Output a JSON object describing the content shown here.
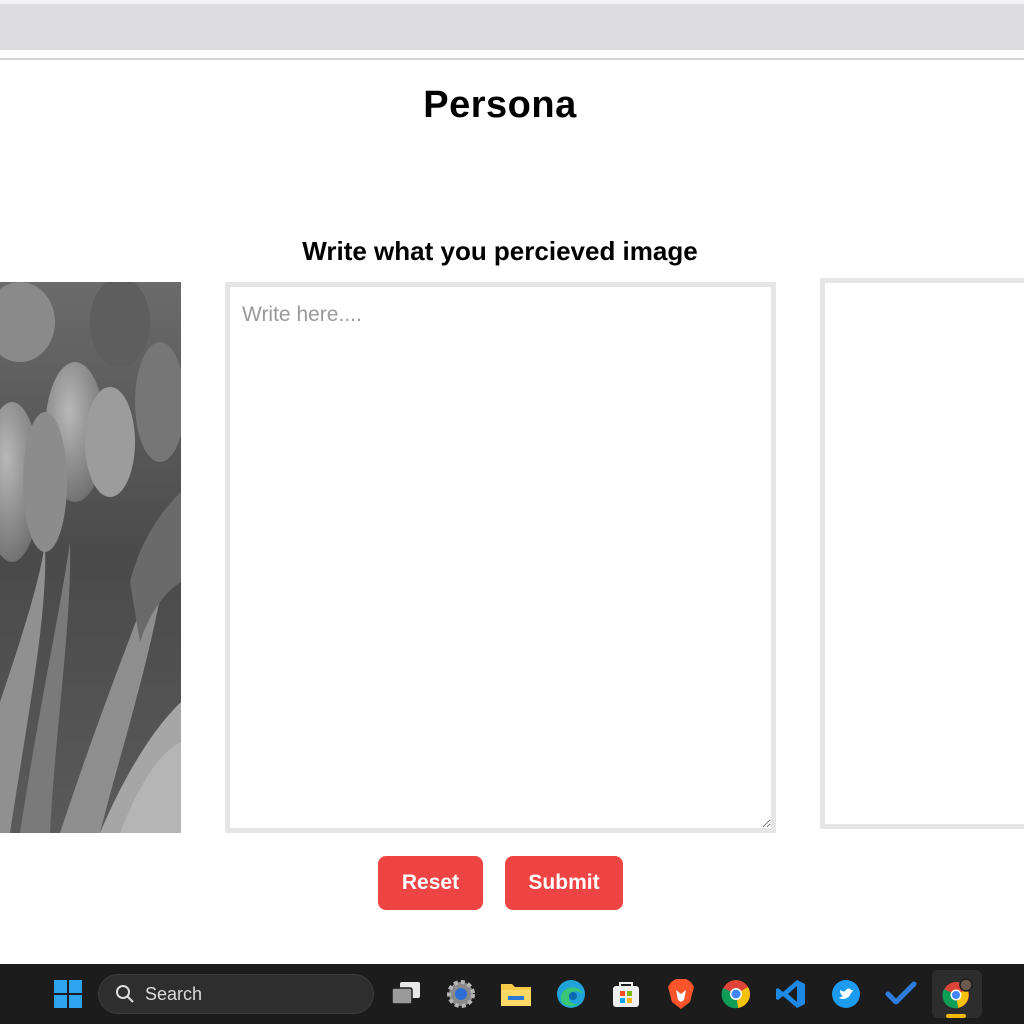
{
  "page": {
    "title": "Persona",
    "heading": "Write what you percieved image"
  },
  "input": {
    "placeholder": "Write here...."
  },
  "buttons": {
    "reset_label": "Reset",
    "submit_label": "Submit"
  },
  "colors": {
    "button_bg": "#ef4444",
    "border": "#e6e6e6",
    "taskbar_bg": "#1c1c1c"
  },
  "taskbar": {
    "search_label": "Search",
    "icons": [
      "windows-start-icon",
      "search-icon",
      "task-view-icon",
      "settings-icon",
      "file-explorer-icon",
      "edge-icon",
      "microsoft-store-icon",
      "brave-icon",
      "chrome-icon",
      "vscode-icon",
      "twitter-icon",
      "todo-icon",
      "chrome-profile-icon"
    ]
  }
}
